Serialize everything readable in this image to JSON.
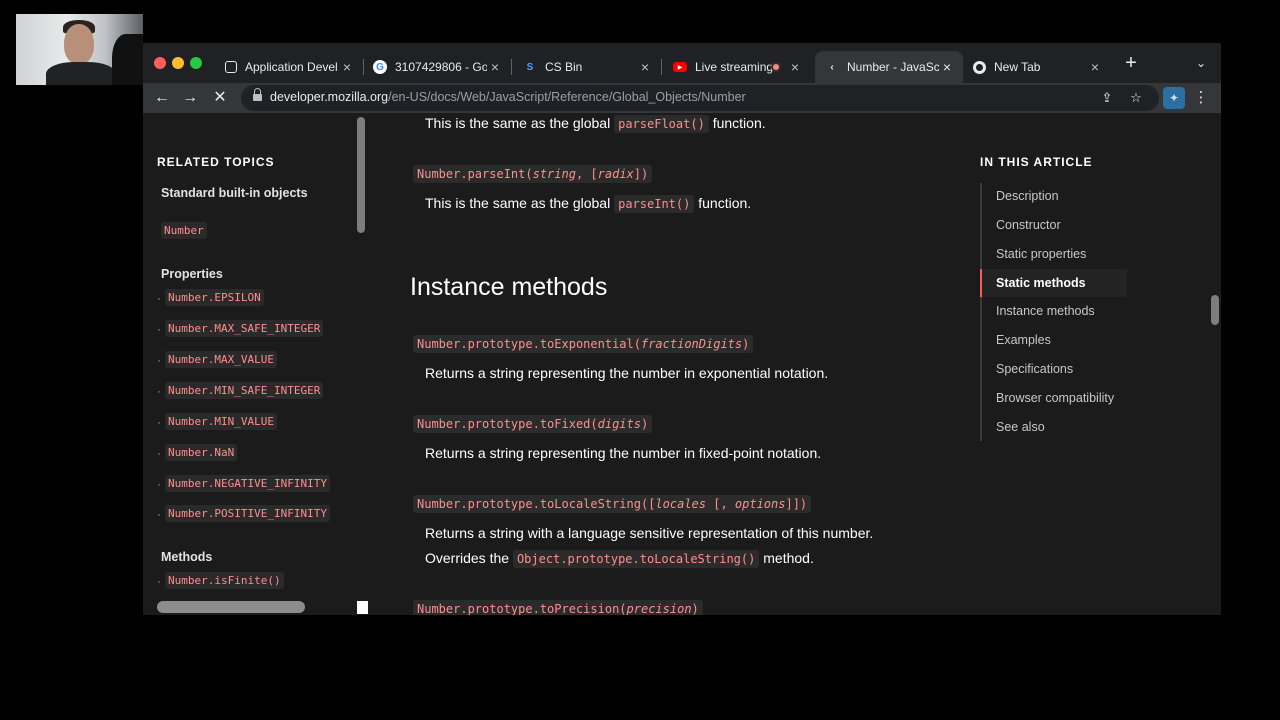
{
  "tabs": [
    {
      "title": "Application Devel",
      "icon": "aws-icon"
    },
    {
      "title": "3107429806 - Go",
      "icon": "google-icon"
    },
    {
      "title": "CS Bin",
      "icon": "csbin-icon"
    },
    {
      "title": "Live streaming",
      "icon": "youtube-icon"
    },
    {
      "title": "Number - JavaSc",
      "icon": "mdn-icon",
      "active": true
    },
    {
      "title": "New Tab",
      "icon": "chrome-icon"
    }
  ],
  "address": {
    "host": "developer.mozilla.org",
    "path": "/en-US/docs/Web/JavaScript/Reference/Global_Objects/Number"
  },
  "sidebar": {
    "heading": "RELATED TOPICS",
    "standard_link": "Standard built-in objects",
    "number_link": "Number",
    "properties_heading": "Properties",
    "properties": [
      "Number.EPSILON",
      "Number.MAX_SAFE_INTEGER",
      "Number.MAX_VALUE",
      "Number.MIN_SAFE_INTEGER",
      "Number.MIN_VALUE",
      "Number.NaN",
      "Number.NEGATIVE_INFINITY",
      "Number.POSITIVE_INFINITY"
    ],
    "methods_heading": "Methods",
    "methods": [
      "Number.isFinite()"
    ]
  },
  "main": {
    "parseFloat_desc_pre": "This is the same as the global",
    "parseFloat_code": "parseFloat()",
    "parseFloat_desc_post": "function.",
    "parseInt_sig_name": "Number.parseInt(",
    "parseInt_sig_arg1": "string",
    "parseInt_sig_mid": ", [",
    "parseInt_sig_arg2": "radix",
    "parseInt_sig_end": "])",
    "parseInt_desc_pre": "This is the same as the global",
    "parseInt_code": "parseInt()",
    "parseInt_desc_post": "function.",
    "section_title": "Instance methods",
    "toExponential_sig": "Number.prototype.toExponential(",
    "toExponential_arg": "fractionDigits",
    "toExponential_end": ")",
    "toExponential_desc": "Returns a string representing the number in exponential notation.",
    "toFixed_sig": "Number.prototype.toFixed(",
    "toFixed_arg": "digits",
    "toFixed_end": ")",
    "toFixed_desc": "Returns a string representing the number in fixed-point notation.",
    "toLocaleString_sig": "Number.prototype.toLocaleString([",
    "toLocaleString_arg1": "locales",
    "toLocaleString_mid": " [, ",
    "toLocaleString_arg2": "options",
    "toLocaleString_end": "]])",
    "toLocaleString_desc1": "Returns a string with a language sensitive representation of this number.",
    "toLocaleString_desc2_pre": "Overrides the",
    "toLocaleString_code": "Object.prototype.toLocaleString()",
    "toLocaleString_desc2_post": "method.",
    "toPrecision_sig": "Number.prototype.toPrecision(",
    "toPrecision_arg": "precision",
    "toPrecision_end": ")"
  },
  "toc": {
    "heading": "IN THIS ARTICLE",
    "items": [
      "Description",
      "Constructor",
      "Static properties",
      "Static methods",
      "Instance methods",
      "Examples",
      "Specifications",
      "Browser compatibility",
      "See also"
    ],
    "active_index": 3
  },
  "colors": {
    "code_text": "#ff8e8e",
    "toc_active_bar": "#ff5a5a",
    "page_bg": "#1b1b1b"
  }
}
